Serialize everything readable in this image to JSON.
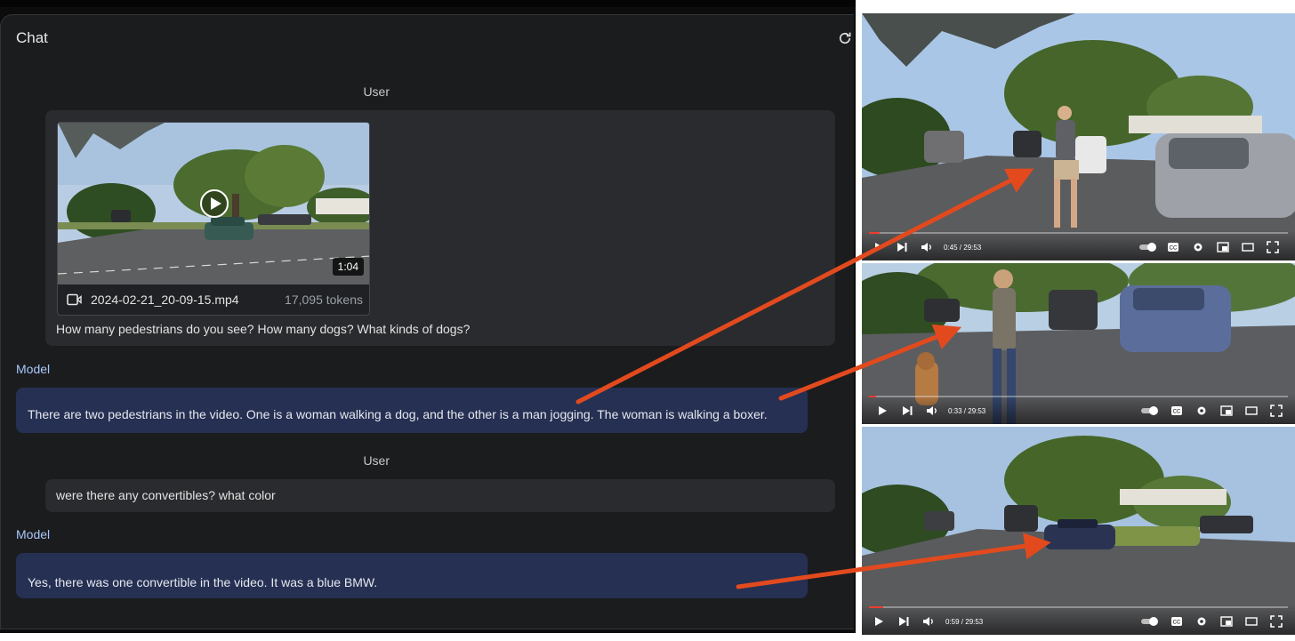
{
  "chat": {
    "title": "Chat",
    "messages": [
      {
        "role": "User",
        "attachment": {
          "filename": "2024-02-21_20-09-15.mp4",
          "tokens": "17,095 tokens",
          "duration": "1:04"
        },
        "text": "How many pedestrians do you see? How many dogs? What kinds of dogs?"
      },
      {
        "role": "Model",
        "text": "There are two pedestrians in the video. One is a woman walking a dog, and the other is a man jogging. The woman is walking a boxer."
      },
      {
        "role": "User",
        "text": "were there any convertibles? what color"
      },
      {
        "role": "Model",
        "text": "Yes, there was one convertible in the video. It was a blue BMW."
      }
    ]
  },
  "frames": [
    {
      "time": "0:45 / 29:53",
      "progress": 0.025
    },
    {
      "time": "0:33 / 29:53",
      "progress": 0.018
    },
    {
      "time": "0:59 / 29:53",
      "progress": 0.033
    }
  ],
  "colors": {
    "arrow": "#e24a1e",
    "model_bubble": "#253053",
    "model_label": "#a8c7fa",
    "progress": "#f03c2e"
  }
}
